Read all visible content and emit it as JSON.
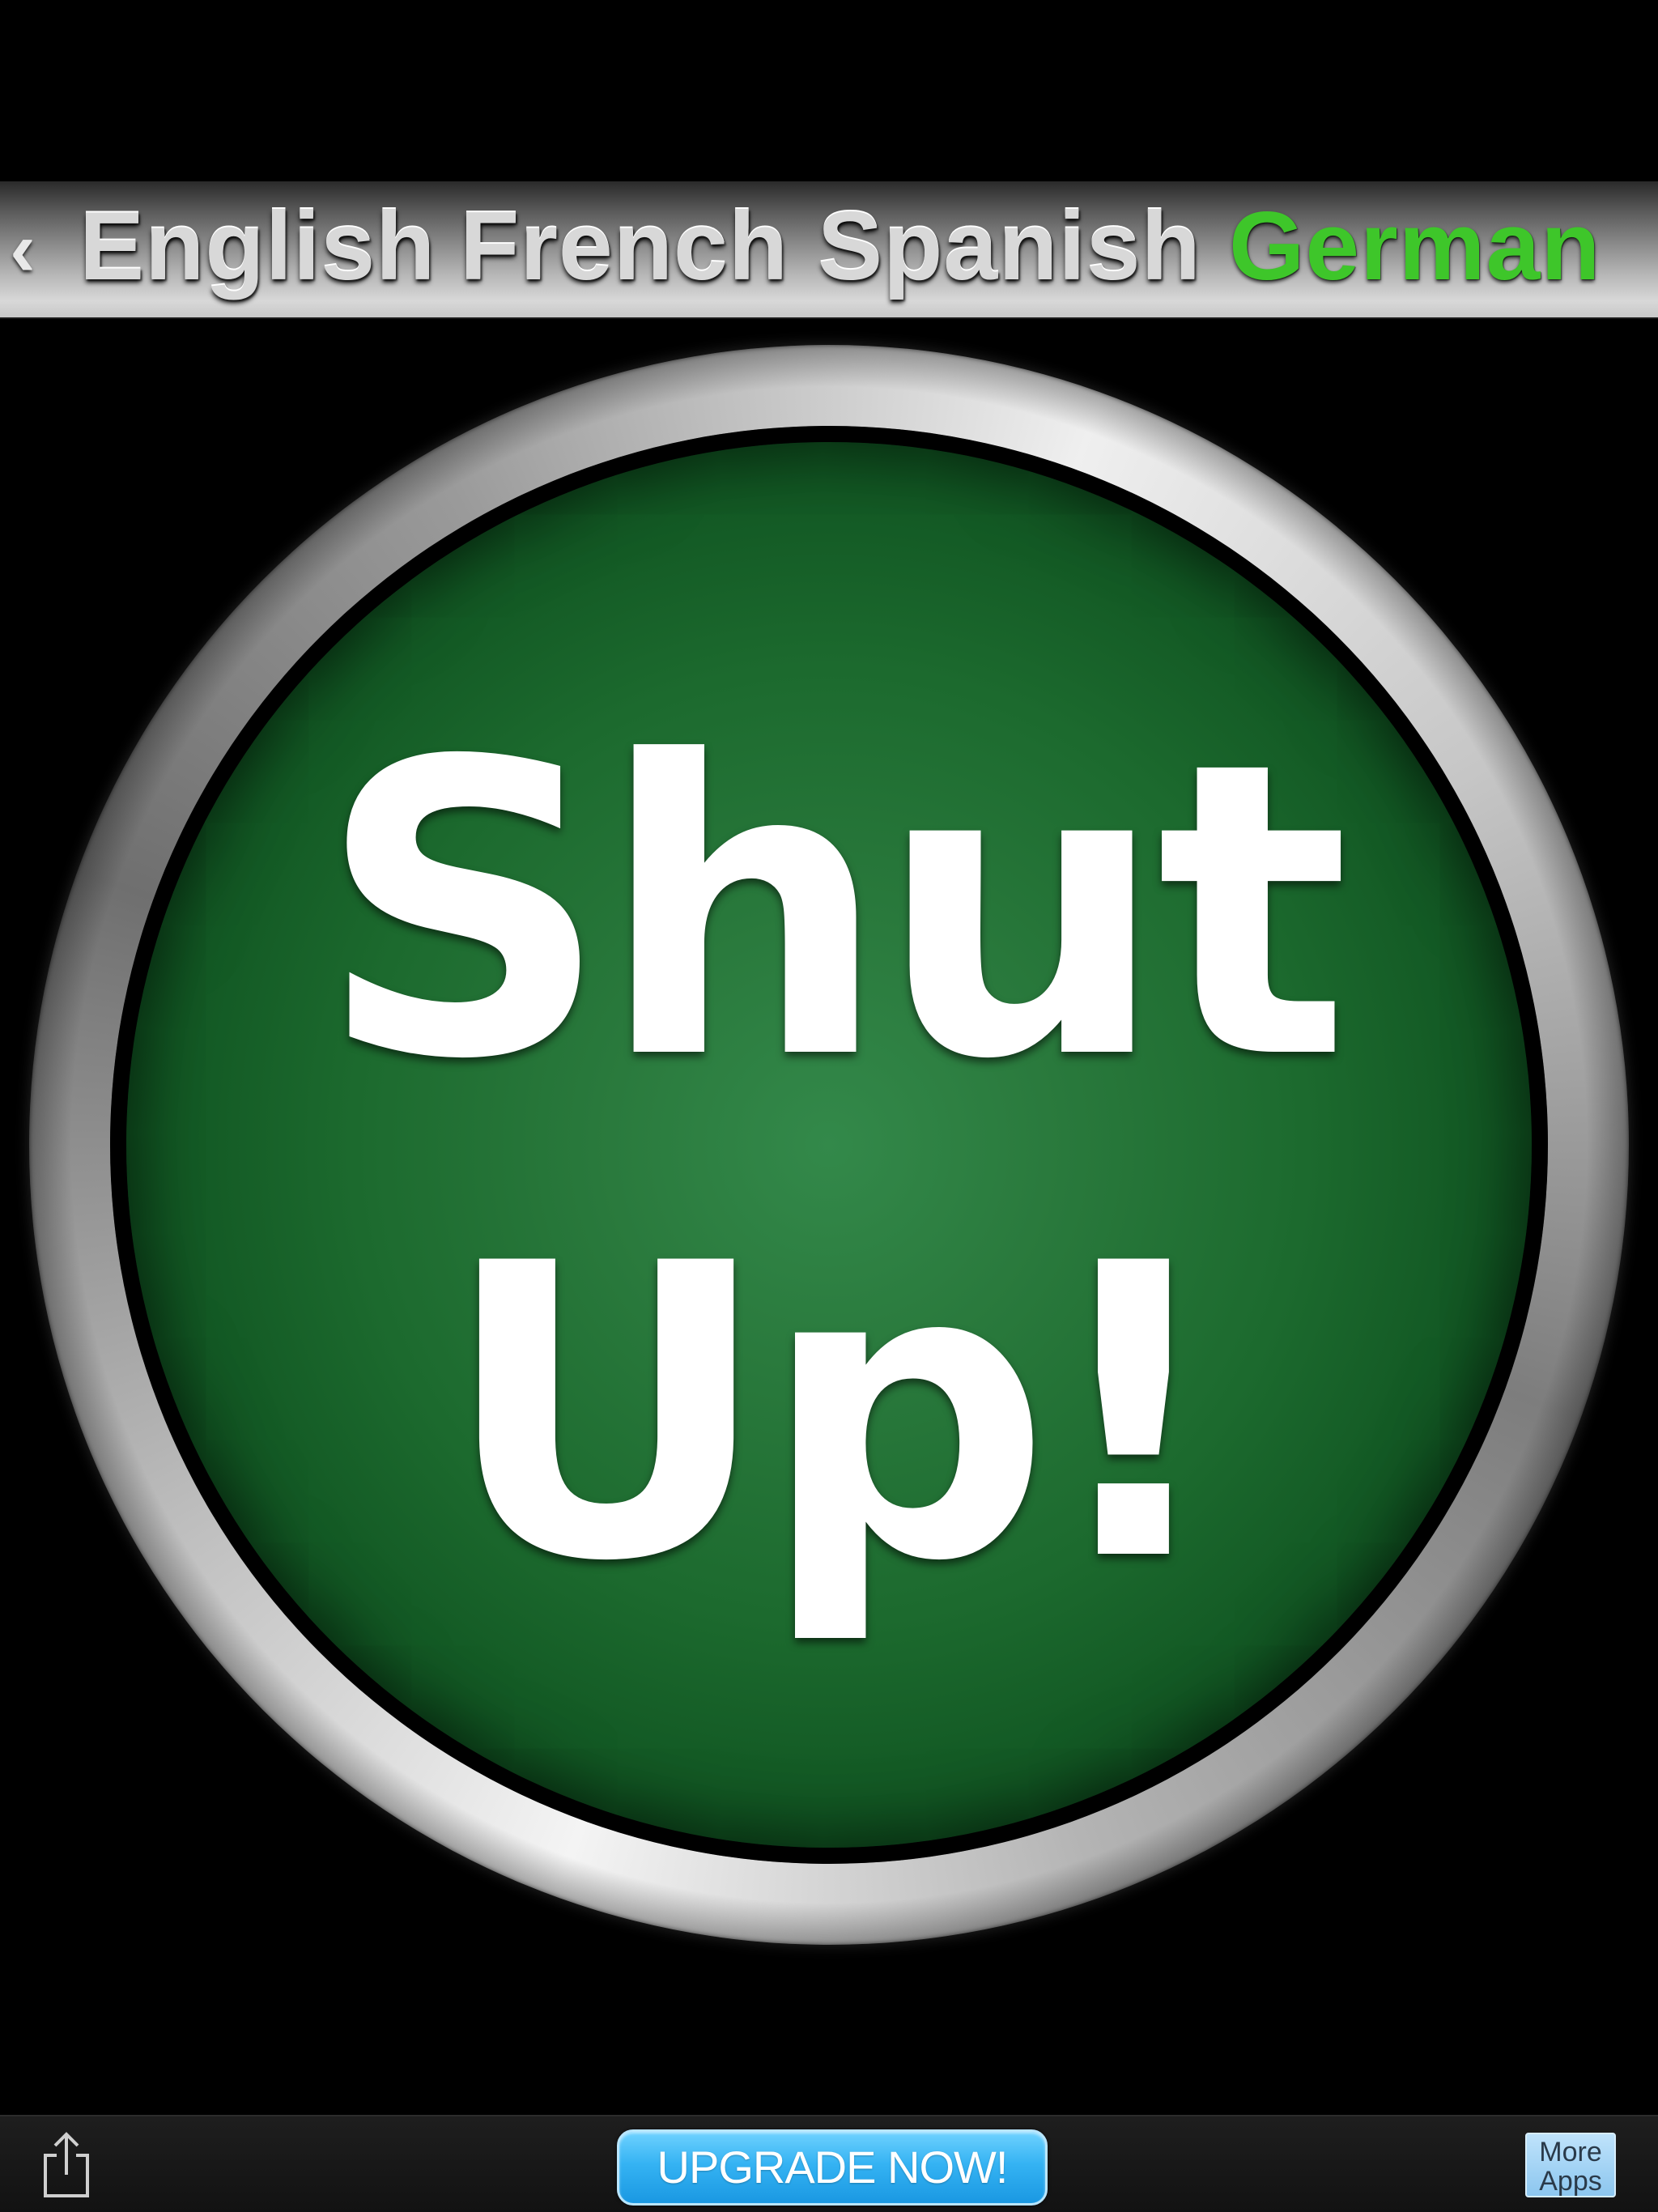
{
  "language_bar": {
    "chevron": "‹",
    "items": [
      {
        "label": "English",
        "active": false
      },
      {
        "label": "French",
        "active": false
      },
      {
        "label": "Spanish",
        "active": false
      },
      {
        "label": "German",
        "active": true
      }
    ],
    "active_color": "#3ec62a",
    "inactive_color": "#d8d8d8"
  },
  "main_button": {
    "line1": "Shut",
    "line2": "Up!",
    "face_color": "#1c6a2e",
    "text_color": "#ffffff"
  },
  "toolbar": {
    "share_icon": "share-icon",
    "upgrade_label": "UPGRADE NOW!",
    "upgrade_color": "#35b3f3",
    "more_apps_line1": "More",
    "more_apps_line2": "Apps"
  }
}
